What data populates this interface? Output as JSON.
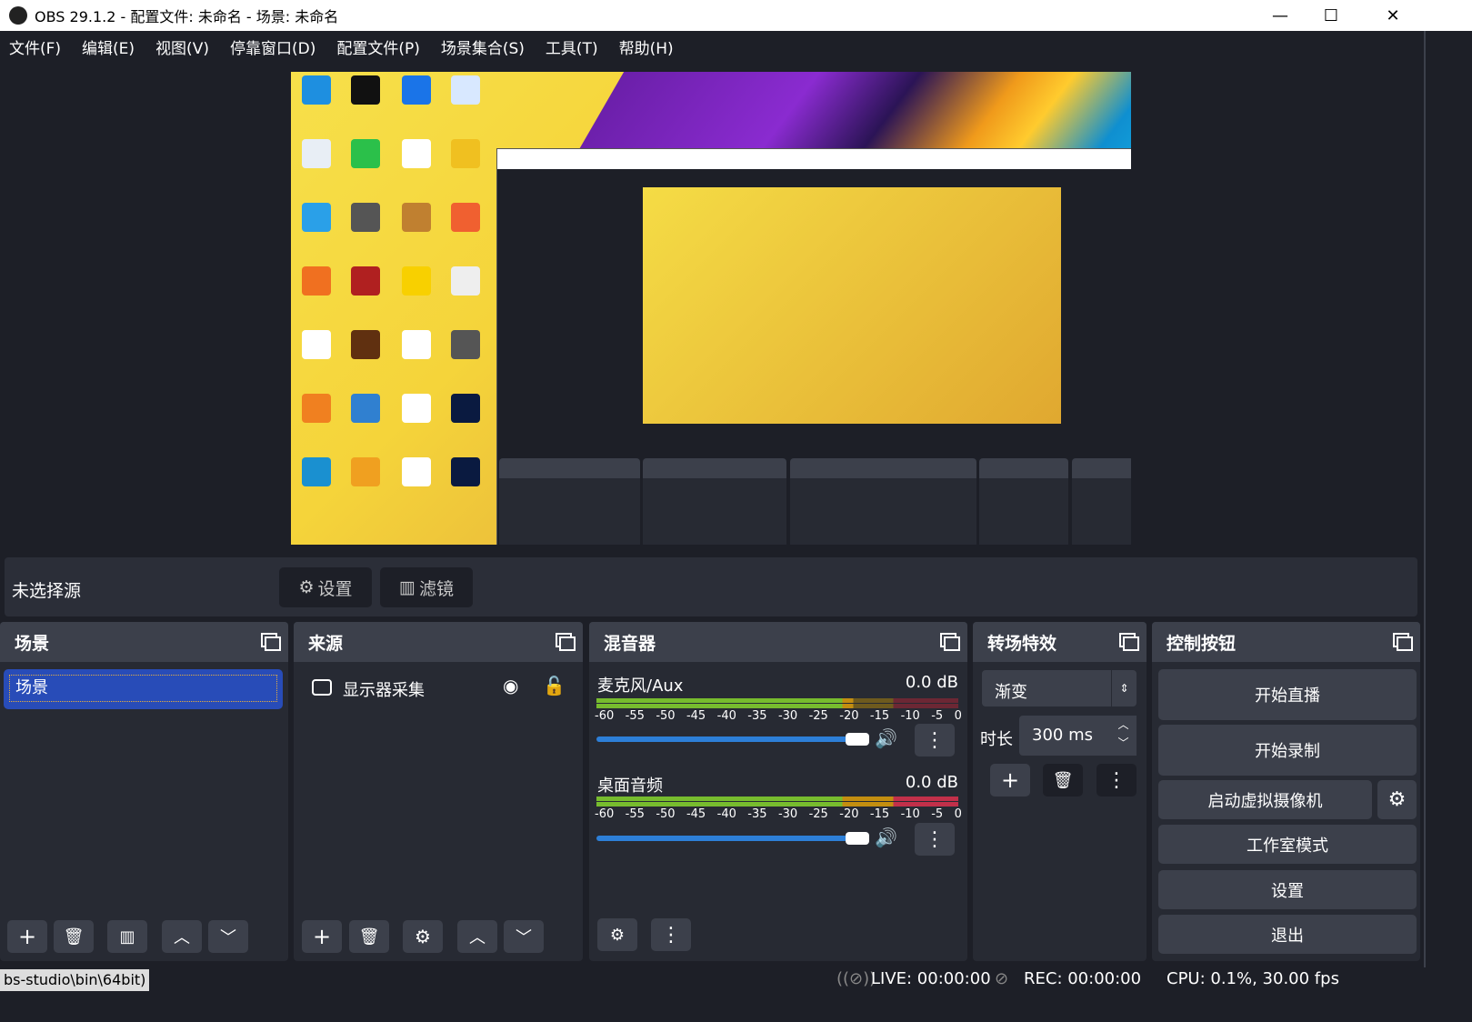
{
  "window": {
    "title": "OBS 29.1.2 - 配置文件: 未命名 - 场景: 未命名",
    "min": "—",
    "max": "☐",
    "close": "✕"
  },
  "menu": [
    "文件(F)",
    "编辑(E)",
    "视图(V)",
    "停靠窗口(D)",
    "配置文件(P)",
    "场景集合(S)",
    "工具(T)",
    "帮助(H)"
  ],
  "source_toolbar": {
    "no_source": "未选择源",
    "settings": "设置",
    "filters": "滤镜"
  },
  "scenes": {
    "title": "场景",
    "items": [
      "场景"
    ]
  },
  "sources": {
    "title": "来源",
    "items": [
      {
        "name": "显示器采集",
        "visible": true,
        "locked": false
      }
    ]
  },
  "mixer": {
    "title": "混音器",
    "ticks": [
      "-60",
      "-55",
      "-50",
      "-45",
      "-40",
      "-35",
      "-30",
      "-25",
      "-20",
      "-15",
      "-10",
      "-5",
      "0"
    ],
    "channels": [
      {
        "name": "麦克风/Aux",
        "level": "0.0 dB",
        "volume": 1.0
      },
      {
        "name": "桌面音频",
        "level": "0.0 dB",
        "volume": 1.0
      }
    ]
  },
  "transitions": {
    "title": "转场特效",
    "selected": "渐变",
    "duration_label": "时长",
    "duration": "300 ms"
  },
  "controls": {
    "title": "控制按钮",
    "start_stream": "开始直播",
    "start_record": "开始录制",
    "virtual_cam": "启动虚拟摄像机",
    "studio_mode": "工作室模式",
    "settings": "设置",
    "exit": "退出"
  },
  "status": {
    "path": "bs-studio\\bin\\64bit)",
    "live": "LIVE: 00:00:00",
    "rec": "REC: 00:00:00",
    "cpu": "CPU: 0.1%, 30.00 fps"
  },
  "colors": {
    "accent": "#284cb8",
    "bg": "#1d1f27",
    "dock": "#272a33",
    "header": "#3c404b"
  }
}
